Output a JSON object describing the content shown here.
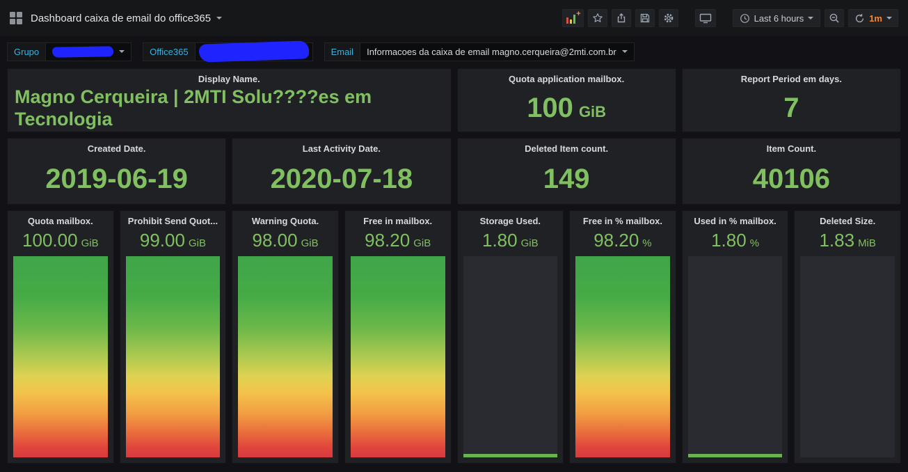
{
  "navbar": {
    "title": "Dashboard caixa de email do office365",
    "time_range": "Last 6 hours",
    "refresh_interval": "1m"
  },
  "filters": {
    "grupo": {
      "label": "Grupo"
    },
    "office365": {
      "label": "Office365"
    },
    "email": {
      "label": "Email",
      "value": "Informacoes da caixa de email magno.cerqueira@2mti.com.br"
    }
  },
  "stats": [
    {
      "title": "Display Name.",
      "value": "Magno Cerqueira | 2MTI Solu????es em Tecnologia"
    },
    {
      "title": "Quota application mailbox.",
      "value": "100",
      "unit": "GiB"
    },
    {
      "title": "Report Period em days.",
      "value": "7"
    },
    {
      "title": "Created Date.",
      "value": "2019-06-19"
    },
    {
      "title": "Last Activity Date.",
      "value": "2020-07-18"
    },
    {
      "title": "Deleted Item count.",
      "value": "149"
    },
    {
      "title": "Item Count.",
      "value": "40106"
    }
  ],
  "gauges": [
    {
      "title": "Quota mailbox.",
      "value": "100.00",
      "unit": "GiB",
      "fill_percent": 100
    },
    {
      "title": "Prohibit Send Quot...",
      "value": "99.00",
      "unit": "GiB",
      "fill_percent": 100
    },
    {
      "title": "Warning Quota.",
      "value": "98.00",
      "unit": "GiB",
      "fill_percent": 100
    },
    {
      "title": "Free in mailbox.",
      "value": "98.20",
      "unit": "GiB",
      "fill_percent": 100
    },
    {
      "title": "Storage Used.",
      "value": "1.80",
      "unit": "GiB",
      "fill_percent": 1.8
    },
    {
      "title": "Free in % mailbox.",
      "value": "98.20",
      "unit": "%",
      "fill_percent": 100
    },
    {
      "title": "Used in % mailbox.",
      "value": "1.80",
      "unit": "%",
      "fill_percent": 1.8
    },
    {
      "title": "Deleted Size.",
      "value": "1.83",
      "unit": "MiB",
      "fill_percent": 0
    }
  ],
  "colors": {
    "accent_green": "#80c060",
    "gradient_top_green": "#3fa548",
    "gradient_bottom_red": "#d93a3f",
    "variable_label_blue": "#33b5e5",
    "refresh_interval_orange": "#f58733",
    "redaction_blue": "#1f24ff",
    "navbar_bg": "#161719",
    "panel_bg": "#202125"
  }
}
